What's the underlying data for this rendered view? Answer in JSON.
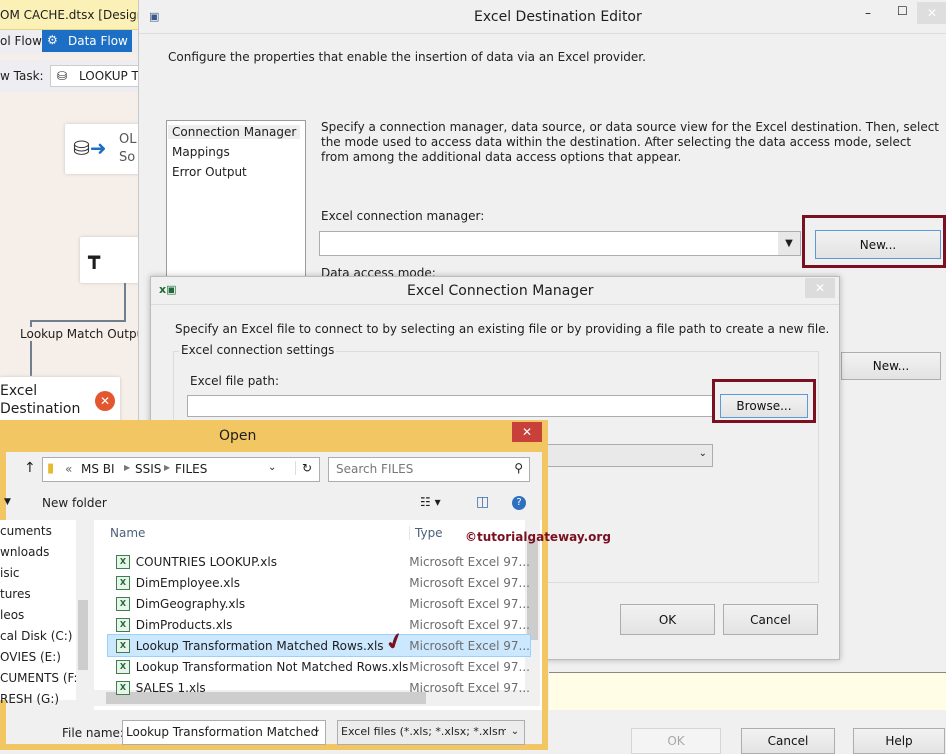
{
  "vs": {
    "doc_tab": "OM CACHE.dtsx [Design]*",
    "control_flow_tab": "ol Flow",
    "data_flow_tab": "Data Flow",
    "task_label": "w Task:",
    "task_value": "LOOKUP T",
    "ole_source": [
      "OL",
      "So"
    ],
    "connector_label": "Lookup Match Output",
    "excel_destination": [
      "Excel",
      "Destination"
    ]
  },
  "editor": {
    "title": "Excel Destination Editor",
    "description": "Configure the properties that enable the insertion of data via an Excel provider.",
    "nav": [
      "Connection Manager",
      "Mappings",
      "Error Output"
    ],
    "instructions": "Specify a connection manager, data source, or data source view for the Excel destination. Then, select the mode used to access data within the destination. After selecting the data access mode, select from among the additional data access options that appear.",
    "conn_label": "Excel connection manager:",
    "conn_value": "",
    "new_label": "New...",
    "access_mode_label": "Data access mode:",
    "new2_label": "New...",
    "ok": "OK",
    "cancel": "Cancel",
    "help": "Help"
  },
  "conn": {
    "title": "Excel Connection Manager",
    "description": "Specify an Excel file to connect to by selecting an existing file or by providing a file path to create a new file.",
    "group": "Excel connection settings",
    "path_label": "Excel file path:",
    "path_value": "",
    "browse": "Browse...",
    "ok": "OK",
    "cancel": "Cancel"
  },
  "open": {
    "title": "Open",
    "breadcrumb": [
      "MS BI",
      "SSIS",
      "FILES"
    ],
    "search_placeholder": "Search FILES",
    "new_folder": "New folder",
    "nav": [
      "cuments",
      "wnloads",
      "isic",
      "tures",
      "leos",
      "cal Disk (C:)",
      "OVIES (E:)",
      "CUMENTS (F:",
      "RESH (G:)"
    ],
    "col_name": "Name",
    "col_type": "Type",
    "files": [
      {
        "name": "COUNTRIES LOOKUP.xls",
        "type": "Microsoft Excel 97..."
      },
      {
        "name": "DimEmployee.xls",
        "type": "Microsoft Excel 97..."
      },
      {
        "name": "DimGeography.xls",
        "type": "Microsoft Excel 97..."
      },
      {
        "name": "DimProducts.xls",
        "type": "Microsoft Excel 97..."
      },
      {
        "name": "Lookup Transformation Matched Rows.xls",
        "type": "Microsoft Excel 97..."
      },
      {
        "name": "Lookup Transformation Not Matched Rows.xls",
        "type": "Microsoft Excel 97..."
      },
      {
        "name": "SALES 1.xls",
        "type": "Microsoft Excel 97..."
      }
    ],
    "selected_index": 4,
    "file_name_label": "File name:",
    "file_name_value": "Lookup Transformation Matched",
    "filter": "Excel files (*.xls; *.xlsx; *.xlsm; *.x"
  },
  "watermark": "©tutorialgateway.org",
  "colors": {
    "highlight": "#7a1020",
    "selection": "#cce8ff",
    "open_frame": "#f2c662"
  }
}
